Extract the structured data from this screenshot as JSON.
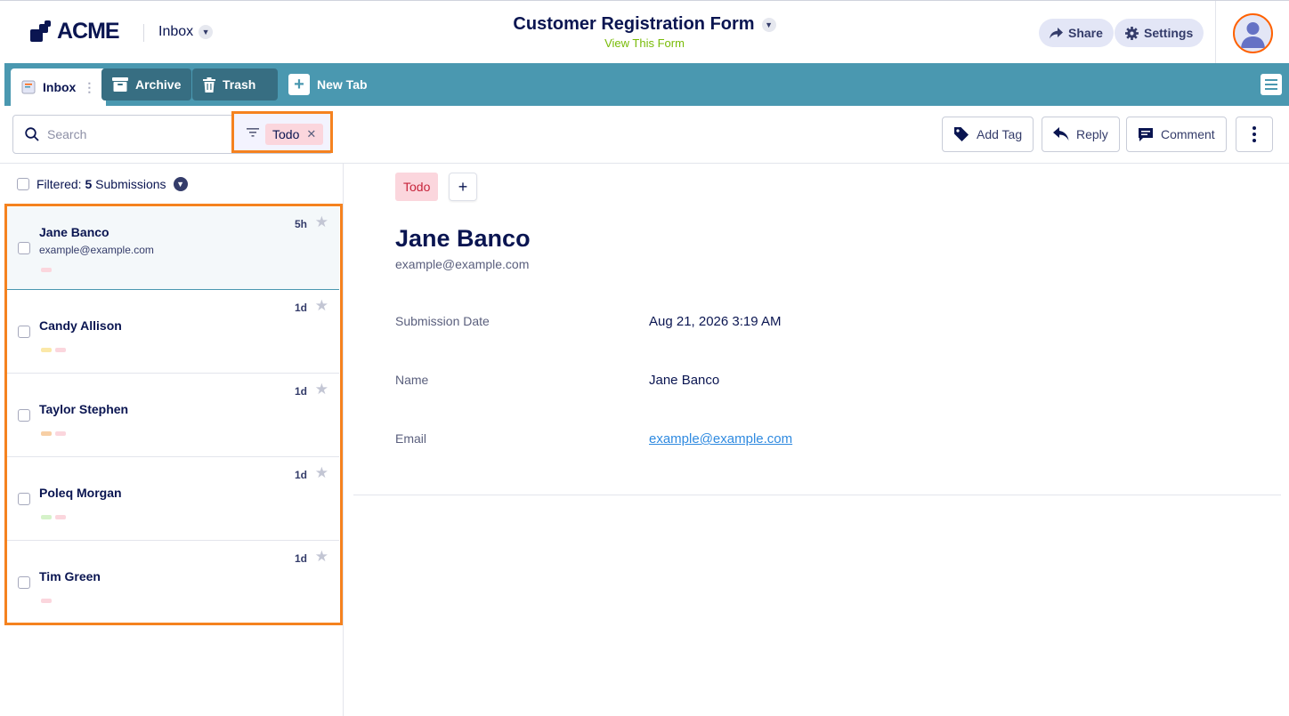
{
  "header": {
    "brand": "ACME",
    "inbox_label": "Inbox",
    "form_title": "Customer Registration Form",
    "view_form_label": "View This Form",
    "share_label": "Share",
    "settings_label": "Settings"
  },
  "tabs": {
    "inbox": "Inbox",
    "archive": "Archive",
    "trash": "Trash",
    "new_tab": "New Tab"
  },
  "toolbar": {
    "search_placeholder": "Search",
    "filter_chip": "Todo",
    "add_tag": "Add Tag",
    "reply": "Reply",
    "comment": "Comment"
  },
  "list": {
    "filtered_prefix": "Filtered:",
    "filtered_count": "5",
    "filtered_suffix": "Submissions",
    "items": [
      {
        "name": "Jane Banco",
        "email": "example@example.com",
        "time": "5h",
        "tag_colors": [
          "#fbd6dd"
        ]
      },
      {
        "name": "Candy Allison",
        "email": "",
        "time": "1d",
        "tag_colors": [
          "#fbe8a8",
          "#fbd6dd"
        ]
      },
      {
        "name": "Taylor Stephen",
        "email": "",
        "time": "1d",
        "tag_colors": [
          "#f7cfa5",
          "#fbd6dd"
        ]
      },
      {
        "name": "Poleq Morgan",
        "email": "",
        "time": "1d",
        "tag_colors": [
          "#d5f2c9",
          "#fbd6dd"
        ]
      },
      {
        "name": "Tim Green",
        "email": "",
        "time": "1d",
        "tag_colors": [
          "#fbd6dd"
        ]
      }
    ]
  },
  "detail": {
    "tag": "Todo",
    "name": "Jane Banco",
    "email": "example@example.com",
    "fields": [
      {
        "label": "Submission Date",
        "value": "Aug 21, 2026 3:19 AM"
      },
      {
        "label": "Name",
        "value": "Jane Banco"
      },
      {
        "label": "Email",
        "value": "example@example.com"
      }
    ]
  },
  "colors": {
    "accent_tabbar": "#4a98b0",
    "highlight_orange": "#f5821f",
    "brand_navy": "#0a1551",
    "todo_bg": "#fbd6dd",
    "todo_text": "#c7243b",
    "link": "#2f8ae0"
  },
  "icons": {
    "brand": "acme-logo-icon",
    "share": "share-arrow-icon",
    "settings": "gear-icon",
    "inbox_tab": "inbox-icon",
    "archive_tab": "archive-box-icon",
    "trash_tab": "trash-icon",
    "new_tab": "plus-icon",
    "search": "search-icon",
    "filter": "filter-icon",
    "add_tag": "tag-icon",
    "reply": "reply-icon",
    "comment": "comment-icon",
    "more": "kebab-menu-icon",
    "star": "star-icon"
  }
}
